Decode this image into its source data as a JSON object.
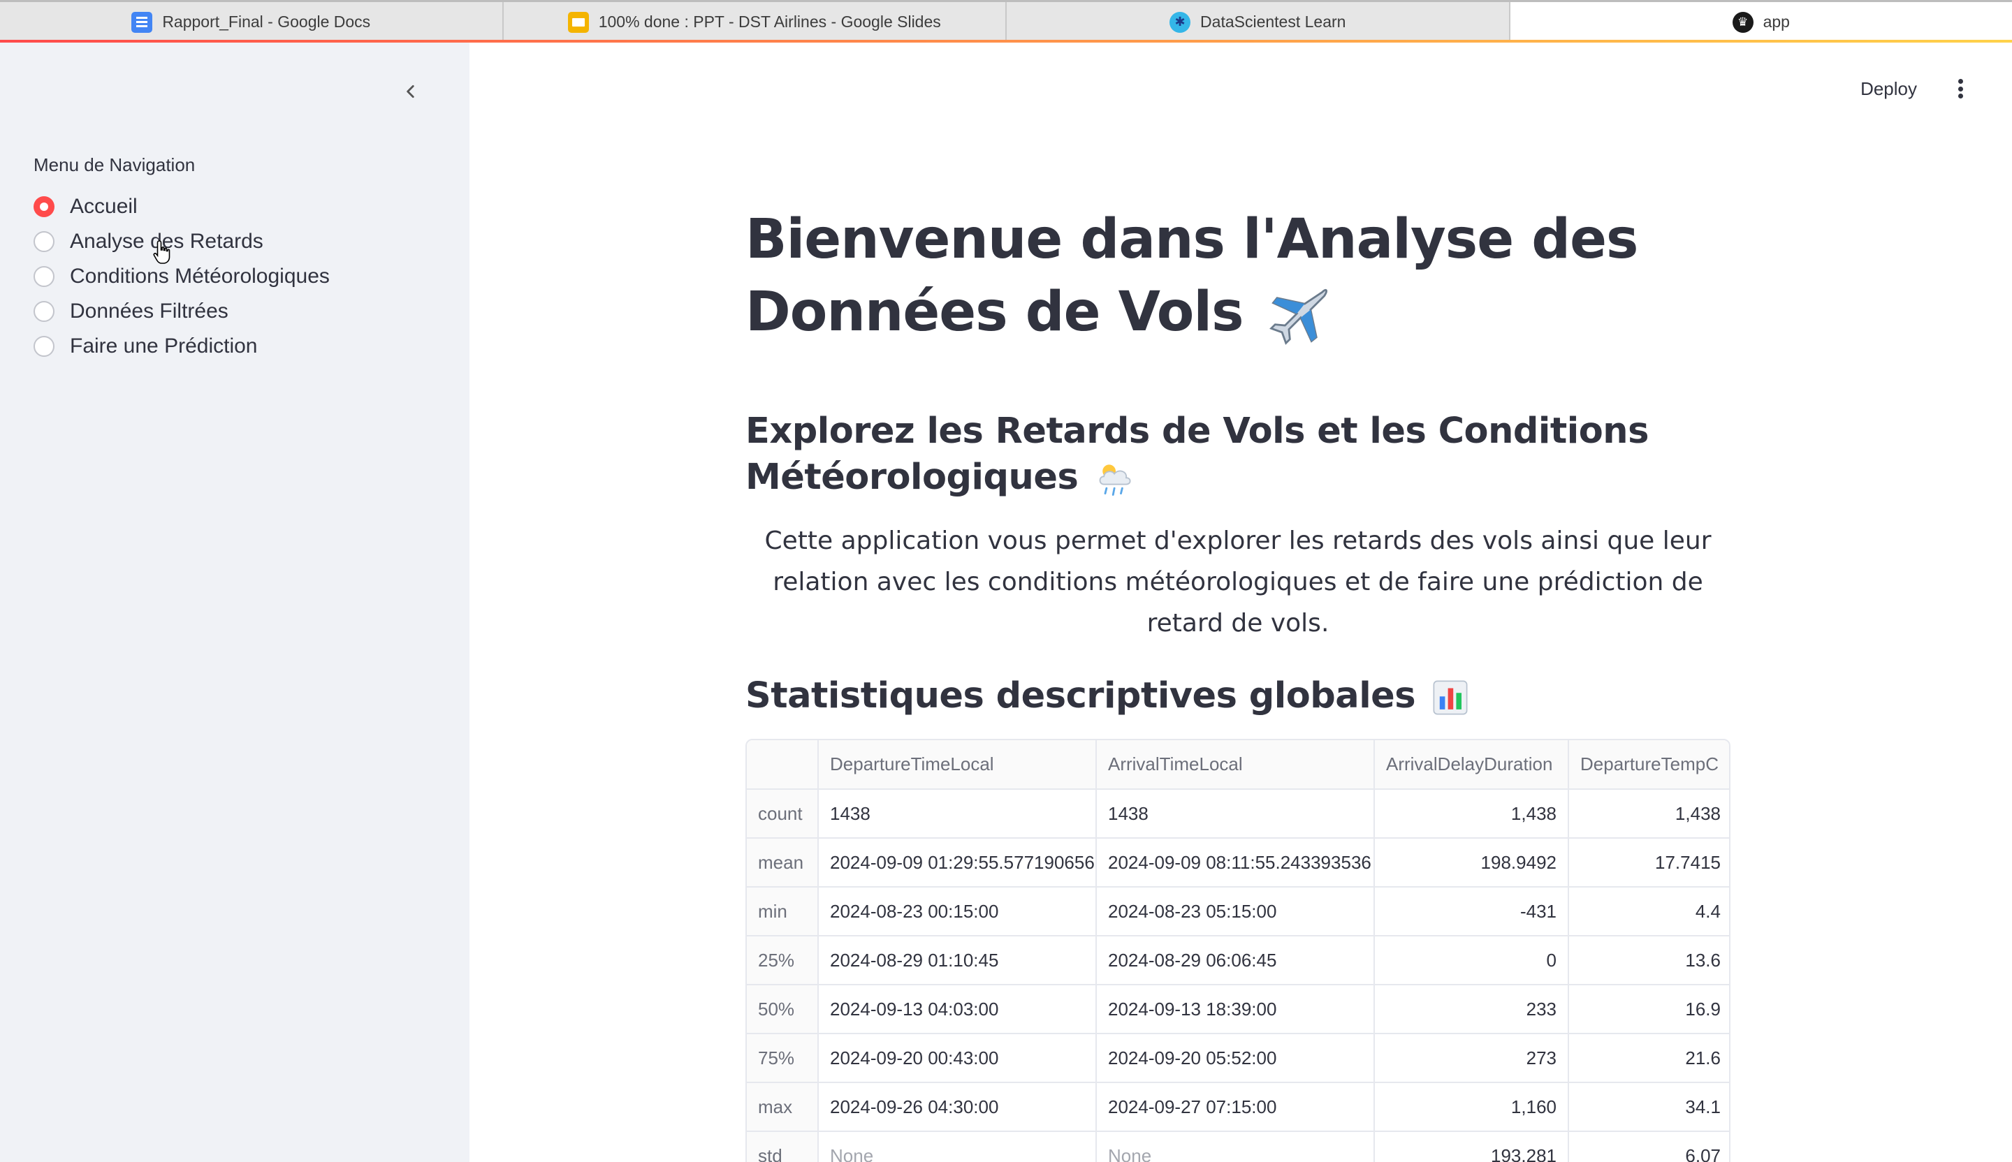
{
  "browser": {
    "tabs": [
      {
        "title": "Rapport_Final - Google Docs",
        "icon": "google-docs-icon",
        "active": false
      },
      {
        "title": "100% done : PPT - DST Airlines - Google Slides",
        "icon": "google-slides-icon",
        "active": false
      },
      {
        "title": "DataScientest Learn",
        "icon": "datascientest-icon",
        "active": false
      },
      {
        "title": "app",
        "icon": "streamlit-icon",
        "active": true
      }
    ]
  },
  "header": {
    "deploy_label": "Deploy",
    "menu_icon": "vertical-dots-icon"
  },
  "sidebar": {
    "collapse_icon": "chevron-left-icon",
    "heading": "Menu de Navigation",
    "items": [
      {
        "label": "Accueil",
        "selected": true
      },
      {
        "label": "Analyse des Retards",
        "selected": false
      },
      {
        "label": "Conditions Météorologiques",
        "selected": false
      },
      {
        "label": "Données Filtrées",
        "selected": false
      },
      {
        "label": "Faire une Prédiction",
        "selected": false
      }
    ]
  },
  "main": {
    "title_line1": "Bienvenue dans l'Analyse des",
    "title_line2": "Données de Vols",
    "title_icon": "airplane-icon",
    "subtitle_line1": "Explorez les Retards de Vols et les Conditions",
    "subtitle_line2": "Météorologiques",
    "subtitle_icon": "cloud-rain-sun-icon",
    "intro": "Cette application vous permet d'explorer les retards des vols ainsi que leur relation avec les conditions météorologiques et de faire une prédiction de retard de vols.",
    "stats_title": "Statistiques descriptives globales",
    "stats_icon": "bar-chart-icon"
  },
  "table": {
    "columns": [
      "",
      "DepartureTimeLocal",
      "ArrivalTimeLocal",
      "ArrivalDelayDuration",
      "DepartureTempC"
    ],
    "rows": [
      [
        "count",
        "1438",
        "1438",
        "1,438",
        "1,438"
      ],
      [
        "mean",
        "2024-09-09 01:29:55.577190656",
        "2024-09-09 08:11:55.243393536",
        "198.9492",
        "17.7415"
      ],
      [
        "min",
        "2024-08-23 00:15:00",
        "2024-08-23 05:15:00",
        "-431",
        "4.4"
      ],
      [
        "25%",
        "2024-08-29 01:10:45",
        "2024-08-29 06:06:45",
        "0",
        "13.6"
      ],
      [
        "50%",
        "2024-09-13 04:03:00",
        "2024-09-13 18:39:00",
        "233",
        "16.9"
      ],
      [
        "75%",
        "2024-09-20 00:43:00",
        "2024-09-20 05:52:00",
        "273",
        "21.6"
      ],
      [
        "max",
        "2024-09-26 04:30:00",
        "2024-09-27 07:15:00",
        "1,160",
        "34.1"
      ],
      [
        "std",
        "None",
        "None",
        "193.281",
        "6.07"
      ]
    ]
  },
  "colors": {
    "accent": "#ff4b4b",
    "sidebar_bg": "#f0f2f6",
    "text": "#31333f",
    "muted": "#6c6f7a"
  }
}
